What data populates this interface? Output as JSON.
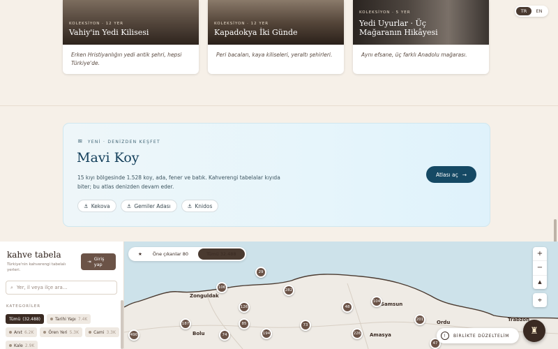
{
  "lang": {
    "tr": "TR",
    "en": "EN",
    "active": "tr"
  },
  "collections": [
    {
      "meta": "KOLEKSİYON · 12 YER",
      "title": "Vahiy'in Yedi Kilisesi",
      "desc": "Erken Hristiyanlığın yedi antik şehri, hepsi Türkiye'de."
    },
    {
      "meta": "KOLEKSİYON · 12 YER",
      "title": "Kapadokya İki Günde",
      "desc": "Peri bacaları, kaya kiliseleri, yeraltı şehirleri."
    },
    {
      "meta": "KOLEKSİYON · 5 YER",
      "title": "Yedi Uyurlar · Üç Mağaranın Hikâyesi",
      "desc": "Aynı efsane, üç farklı Anadolu mağarası."
    }
  ],
  "promo": {
    "kicker": "YENİ · DENİZDEN KEŞFET",
    "title": "Mavi Koy",
    "text": "15 kıyı bölgesinde 1.528 koy, ada, fener ve batık. Kahverengi tabelalar kıyıda biter; bu atlas denizden devam eder.",
    "chips": [
      "Kekova",
      "Gemiler Adası",
      "Knidos"
    ],
    "cta": "Atlası aç"
  },
  "sidebar": {
    "brand": "kahve tabela",
    "tagline": "Türkiye'nin kahverengi tabelalı yerleri.",
    "login": "Giriş yap",
    "search_placeholder": "Yer, il veya ilçe ara...",
    "categories_heading": "KATEGORİLER",
    "categories": [
      {
        "label": "Tümü",
        "count": "(32.488)",
        "active": true
      },
      {
        "label": "Tarihi Yapı",
        "count": "7.4K"
      },
      {
        "label": "Anıt",
        "count": "6.2K"
      },
      {
        "label": "Ören Yeri",
        "count": "5.3K"
      },
      {
        "label": "Cami",
        "count": "3.3K"
      },
      {
        "label": "Kale",
        "count": "2.9K"
      }
    ]
  },
  "map": {
    "filters": [
      {
        "label": "Öne çıkanlar 80",
        "active": false
      },
      {
        "label": "Tümü 32.488",
        "active": true
      }
    ],
    "zoom_in": "+",
    "zoom_out": "−",
    "compass": "▲",
    "edit_label": "BİRLİKTE DÜZELTELİM",
    "cities": [
      "Zonguldak",
      "Trabzon",
      "Bolu",
      "Ordu",
      "Amasya",
      "Samsun"
    ],
    "clusters": [
      "29",
      "106",
      "282",
      "126",
      "48",
      "104",
      "187",
      "194",
      "73",
      "201",
      "85",
      "490",
      "74",
      "226",
      "47"
    ],
    "colors": {
      "cluster": "#6b5347",
      "land": "#efebe5",
      "sea": "#cde2ea"
    }
  }
}
